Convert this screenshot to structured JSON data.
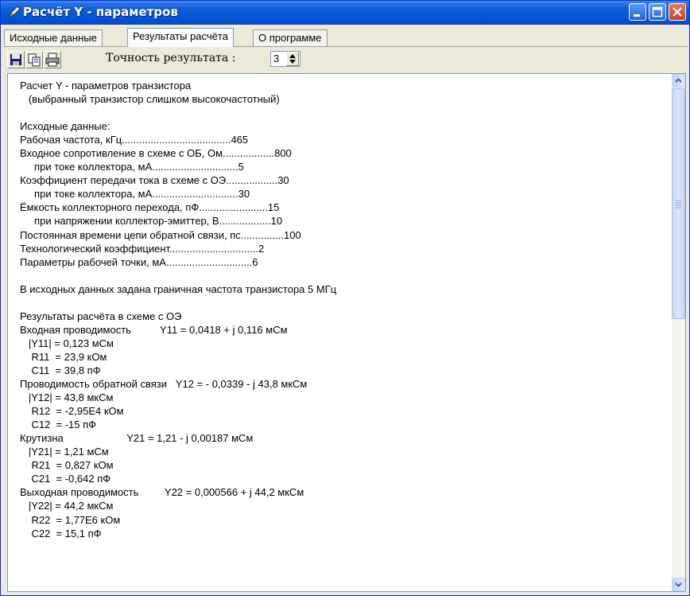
{
  "window": {
    "title": "Расчёт Y - параметров",
    "colors": {
      "titlebar": "#0a5ad8",
      "close": "#c9421b",
      "face": "#ece9d8"
    }
  },
  "tabs": [
    {
      "label": "Исходные данные",
      "active": false
    },
    {
      "label": "Результаты расчёта",
      "active": true
    },
    {
      "label": "О программе",
      "active": false
    }
  ],
  "toolbar": {
    "icons": [
      "save-icon",
      "copy-icon",
      "print-icon"
    ],
    "precision_label": "Точность результата :",
    "precision_value": "3"
  },
  "results": {
    "lines": [
      "Расчет Y - параметров транзистора",
      "   (выбранный транзистор слишком высокочастотный)",
      "",
      "Исходные данные:",
      "Рабочая частота, кГц......................................465",
      "Входное сопротивление в схеме с ОБ, Ом..................800",
      "     при токе коллектора, мА..............................5",
      "Коэффициент передачи тока в схеме с ОЭ..................30",
      "     при токе коллектора, мА..............................30",
      "Ёмкость коллекторного перехода, пФ........................15",
      "     при напряжении коллектор-эмиттер, В..................10",
      "Постоянная времени цепи обратной связи, пс...............100",
      "Технологический коэффициент...............................2",
      "Параметры рабочей точки, мА..............................6",
      "",
      "В исходных данных задана граничная частота транзистора 5 МГц",
      "",
      "Результаты расчёта в схеме с ОЭ",
      "Входная проводимость          Y11 = 0,0418 + j 0,116 мСм",
      "   |Y11| = 0,123 мСм",
      "    R11  = 23,9 кОм",
      "    C11  = 39,8 пФ",
      "Проводимость обратной связи   Y12 = - 0,0339 - j 43,8 мкСм",
      "   |Y12| = 43,8 мкСм",
      "    R12  = -2,95E4 кОм",
      "    C12  = -15 пФ",
      "Крутизна                      Y21 = 1,21 - j 0,00187 мСм",
      "   |Y21| = 1,21 мСм",
      "    R21  = 0,827 кОм",
      "    C21  = -0,642 пФ",
      "Выходная проводимость         Y22 = 0,000566 + j 44,2 мкСм",
      "   |Y22| = 44,2 мкСм",
      "    R22  = 1,77E6 кОм",
      "    C22  = 15,1 пФ"
    ]
  }
}
